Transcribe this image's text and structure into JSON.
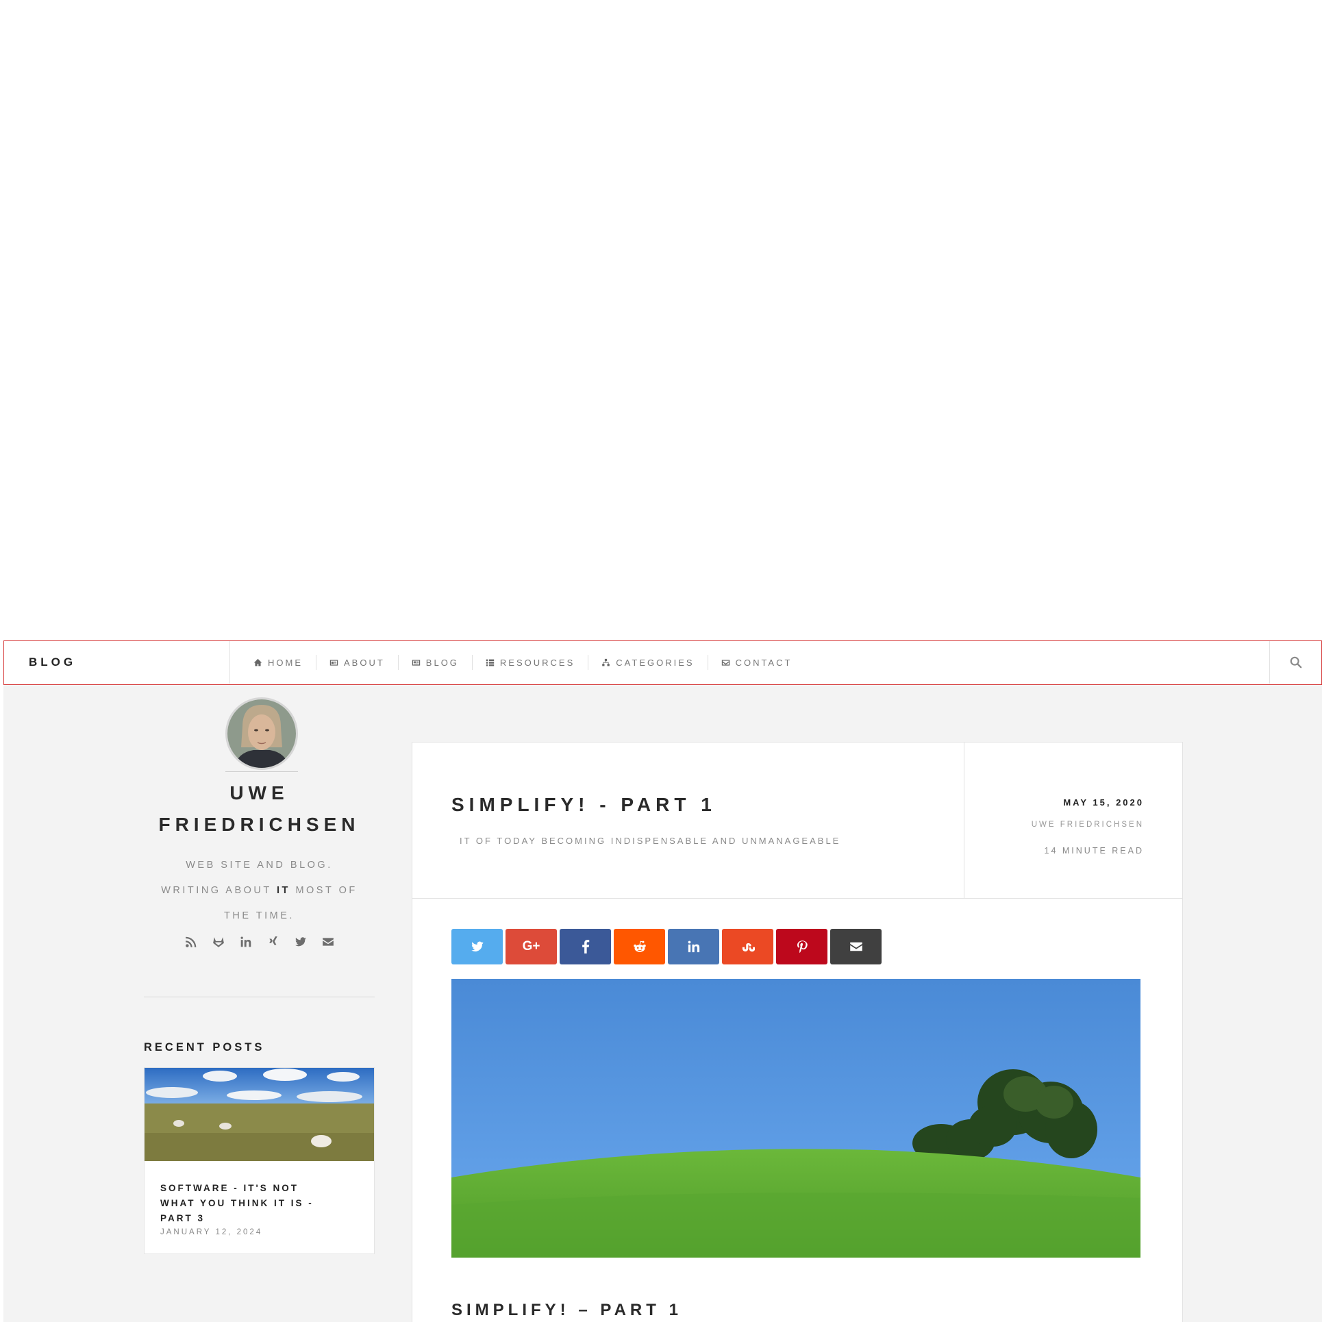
{
  "topbar": {
    "brand": "BLOG",
    "nav": [
      {
        "label": "HOME",
        "icon": "home-icon"
      },
      {
        "label": "ABOUT",
        "icon": "id-card-icon"
      },
      {
        "label": "BLOG",
        "icon": "newspaper-icon"
      },
      {
        "label": "RESOURCES",
        "icon": "list-icon"
      },
      {
        "label": "CATEGORIES",
        "icon": "sitemap-icon"
      },
      {
        "label": "CONTACT",
        "icon": "envelope-icon"
      }
    ],
    "search_icon": "search-icon",
    "accent_border": "#d63a3a"
  },
  "sidebar": {
    "author_line1": "UWE",
    "author_line2": "FRIEDRICHSEN",
    "bio_line1": "WEB SITE AND BLOG.",
    "bio_line2_pre": "WRITING ABOUT",
    "bio_line2_bold": "IT",
    "bio_line2_post": "MOST OF",
    "bio_line3": "THE TIME.",
    "socials": [
      "rss-icon",
      "gitlab-icon",
      "linkedin-icon",
      "xing-icon",
      "twitter-icon",
      "envelope-icon"
    ],
    "recent_title": "RECENT POSTS",
    "recent_posts": [
      {
        "title": "SOFTWARE - IT'S NOT WHAT YOU THINK IT IS - PART 3",
        "date": "JANUARY 12, 2024"
      }
    ]
  },
  "post": {
    "title": "SIMPLIFY! - PART 1",
    "subtitle": "IT OF TODAY BECOMING INDISPENSABLE AND UNMANAGEABLE",
    "date": "MAY 15, 2020",
    "author": "UWE FRIEDRICHSEN",
    "read_time": "14 MINUTE READ",
    "share_buttons": [
      {
        "name": "twitter",
        "color": "#55acee"
      },
      {
        "name": "google-plus",
        "color": "#dd4b39",
        "label": "G+"
      },
      {
        "name": "facebook",
        "color": "#3b5998"
      },
      {
        "name": "reddit",
        "color": "#ff5700"
      },
      {
        "name": "linkedin",
        "color": "#4875b4"
      },
      {
        "name": "stumbleupon",
        "color": "#eb4924"
      },
      {
        "name": "pinterest",
        "color": "#bd081c"
      },
      {
        "name": "email",
        "color": "#404040"
      }
    ],
    "content_title": "SIMPLIFY! – PART 1"
  }
}
